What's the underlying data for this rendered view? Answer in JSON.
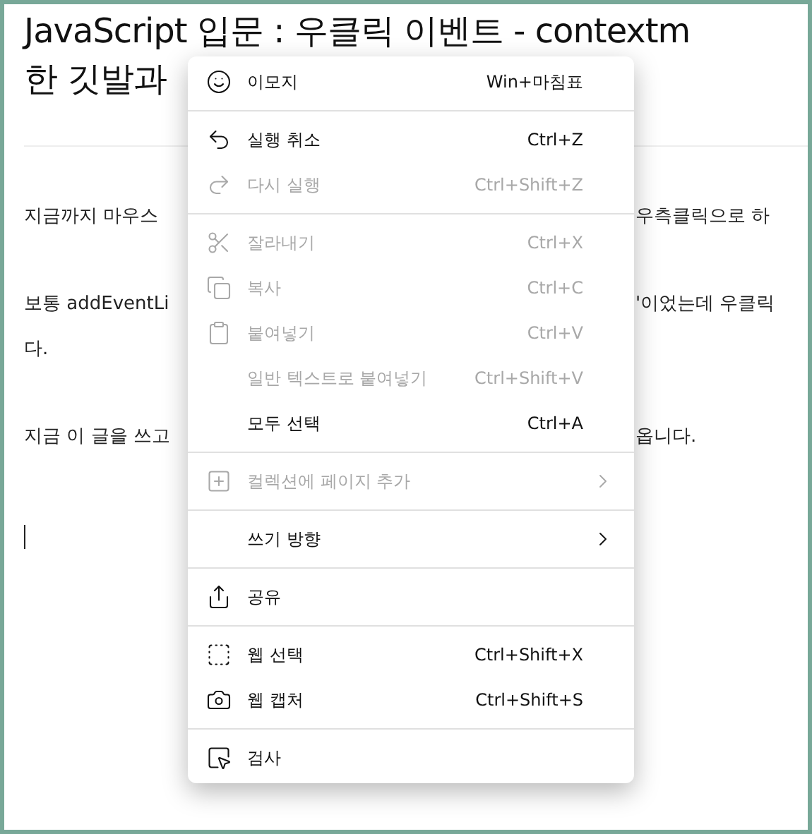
{
  "article": {
    "title_lines": [
      "JavaScript 입문 : 우클릭 이벤트 - contextm",
      "한 깃발과"
    ],
    "paragraphs": [
      {
        "lines": [
          {
            "left": "지금까지 마우스",
            "right": "우측클릭으로 하"
          }
        ]
      },
      {
        "lines": [
          {
            "left": "보통 addEventLi",
            "right": "'이었는데 우클릭"
          },
          {
            "left": "다."
          }
        ]
      },
      {
        "lines": [
          {
            "left": "지금 이 글을 쓰고",
            "right": "옵니다."
          }
        ]
      }
    ]
  },
  "menu": {
    "groups": [
      {
        "items": [
          {
            "label": "이모지",
            "shortcut": "Win+마침표",
            "disabled": false
          }
        ]
      },
      {
        "items": [
          {
            "label": "실행 취소",
            "shortcut": "Ctrl+Z",
            "disabled": false
          },
          {
            "label": "다시 실행",
            "shortcut": "Ctrl+Shift+Z",
            "disabled": true
          }
        ]
      },
      {
        "items": [
          {
            "label": "잘라내기",
            "shortcut": "Ctrl+X",
            "disabled": true
          },
          {
            "label": "복사",
            "shortcut": "Ctrl+C",
            "disabled": true
          },
          {
            "label": "붙여넣기",
            "shortcut": "Ctrl+V",
            "disabled": true
          },
          {
            "label": "일반 텍스트로 붙여넣기",
            "shortcut": "Ctrl+Shift+V",
            "disabled": true
          },
          {
            "label": "모두 선택",
            "shortcut": "Ctrl+A",
            "disabled": false
          }
        ]
      },
      {
        "items": [
          {
            "label": "컬렉션에 페이지 추가",
            "submenu": true,
            "disabled": true
          }
        ]
      },
      {
        "items": [
          {
            "label": "쓰기 방향",
            "submenu": true,
            "disabled": false
          }
        ]
      },
      {
        "items": [
          {
            "label": "공유",
            "disabled": false
          }
        ]
      },
      {
        "items": [
          {
            "label": "웹 선택",
            "shortcut": "Ctrl+Shift+X",
            "disabled": false
          },
          {
            "label": "웹 캡처",
            "shortcut": "Ctrl+Shift+S",
            "disabled": false
          }
        ]
      },
      {
        "items": [
          {
            "label": "검사",
            "disabled": false
          }
        ]
      }
    ]
  }
}
